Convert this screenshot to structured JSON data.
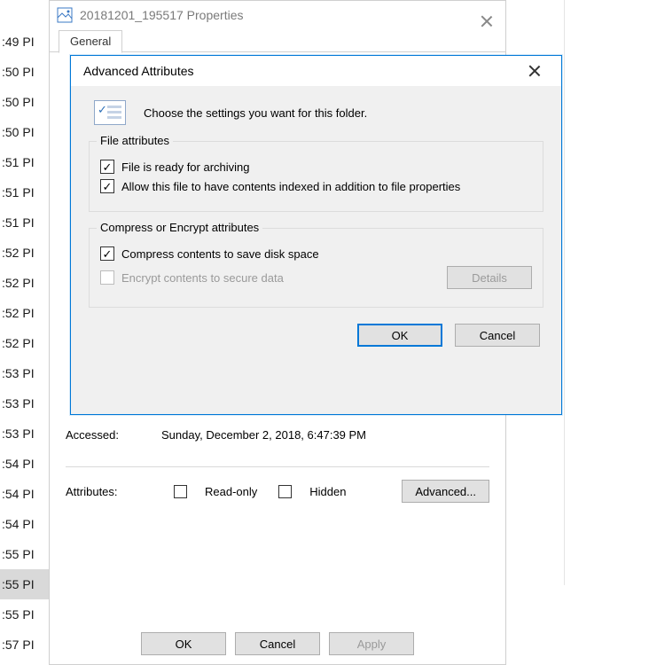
{
  "bg_times": [
    ":49 PI",
    ":50 PI",
    ":50 PI",
    ":50 PI",
    ":51 PI",
    ":51 PI",
    ":51 PI",
    ":52 PI",
    ":52 PI",
    ":52 PI",
    ":52 PI",
    ":53 PI",
    ":53 PI",
    ":53 PI",
    ":54 PI",
    ":54 PI",
    ":54 PI",
    ":55 PI",
    ":55 PI",
    ":55 PI",
    ":57 PI"
  ],
  "bg_highlight_index": 18,
  "properties": {
    "title": "20181201_195517 Properties",
    "tabs": {
      "general": "General"
    },
    "accessed_label": "Accessed:",
    "accessed_value": "Sunday, December 2, 2018, 6:47:39 PM",
    "attributes_label": "Attributes:",
    "readonly_label": "Read-only",
    "hidden_label": "Hidden",
    "advanced_btn": "Advanced...",
    "ok": "OK",
    "cancel": "Cancel",
    "apply": "Apply"
  },
  "advanced": {
    "title": "Advanced Attributes",
    "intro": "Choose the settings you want for this folder.",
    "group1_title": "File attributes",
    "cb_archive": "File is ready for archiving",
    "cb_index": "Allow this file to have contents indexed in addition to file properties",
    "group2_title": "Compress or Encrypt attributes",
    "cb_compress": "Compress contents to save disk space",
    "cb_encrypt": "Encrypt contents to secure data",
    "details_btn": "Details",
    "ok": "OK",
    "cancel": "Cancel"
  }
}
